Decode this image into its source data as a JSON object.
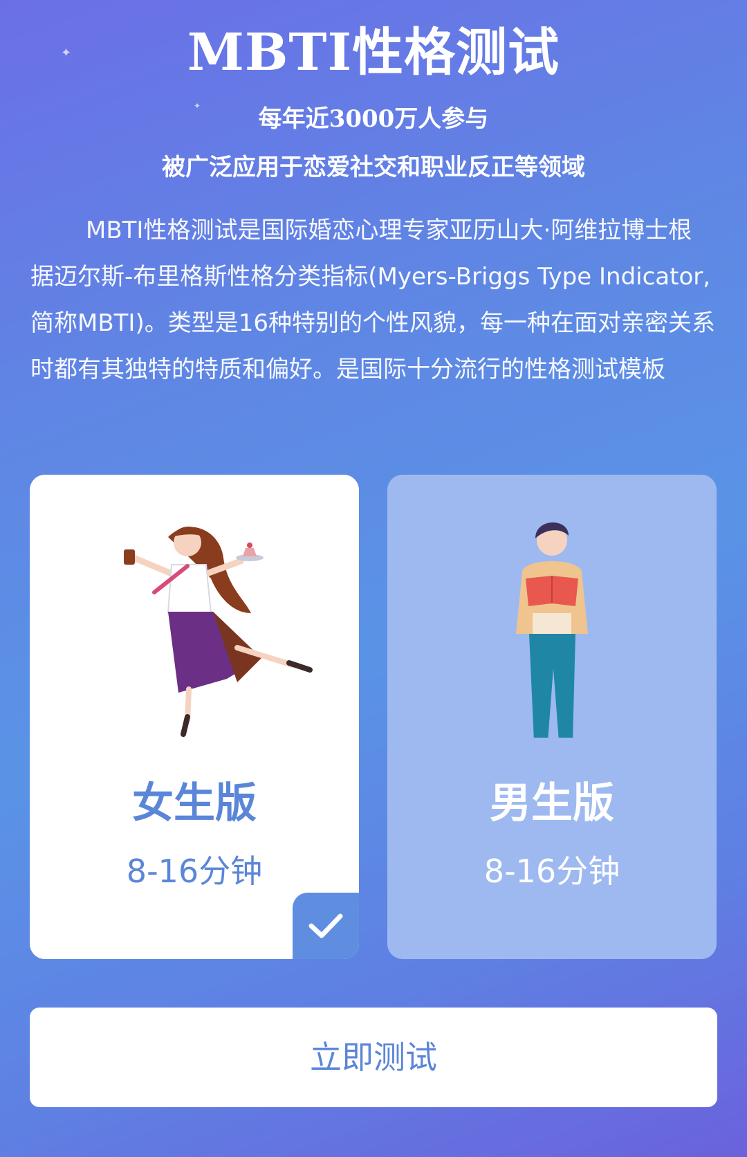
{
  "header": {
    "title": "MBTI性格测试",
    "subtitle_line1": "每年近3000万人参与",
    "subtitle_line2": "被广泛应用于恋爱社交和职业反正等领域"
  },
  "intro": {
    "text": "MBTI性格测试是国际婚恋心理专家亚历山大·阿维拉博士根据迈尔斯-布里格斯性格分类指标(Myers-Briggs Type Indicator,简称MBTI)。类型是16种特别的个性风貌，每一种在面对亲密关系时都有其独特的特质和偏好。是国际十分流行的性格测试模板"
  },
  "options": [
    {
      "title": "女生版",
      "duration": "8-16分钟",
      "selected": true,
      "icon": "female-figure-icon"
    },
    {
      "title": "男生版",
      "duration": "8-16分钟",
      "selected": false,
      "icon": "male-figure-icon"
    }
  ],
  "check_icon": "check-icon",
  "start_button": {
    "label": "立即测试"
  },
  "colors": {
    "accent": "#5b86d8",
    "card_selected_bg": "#ffffff",
    "card_unselected_bg": "#9db9f0",
    "check_bg": "#5f8ee0"
  }
}
